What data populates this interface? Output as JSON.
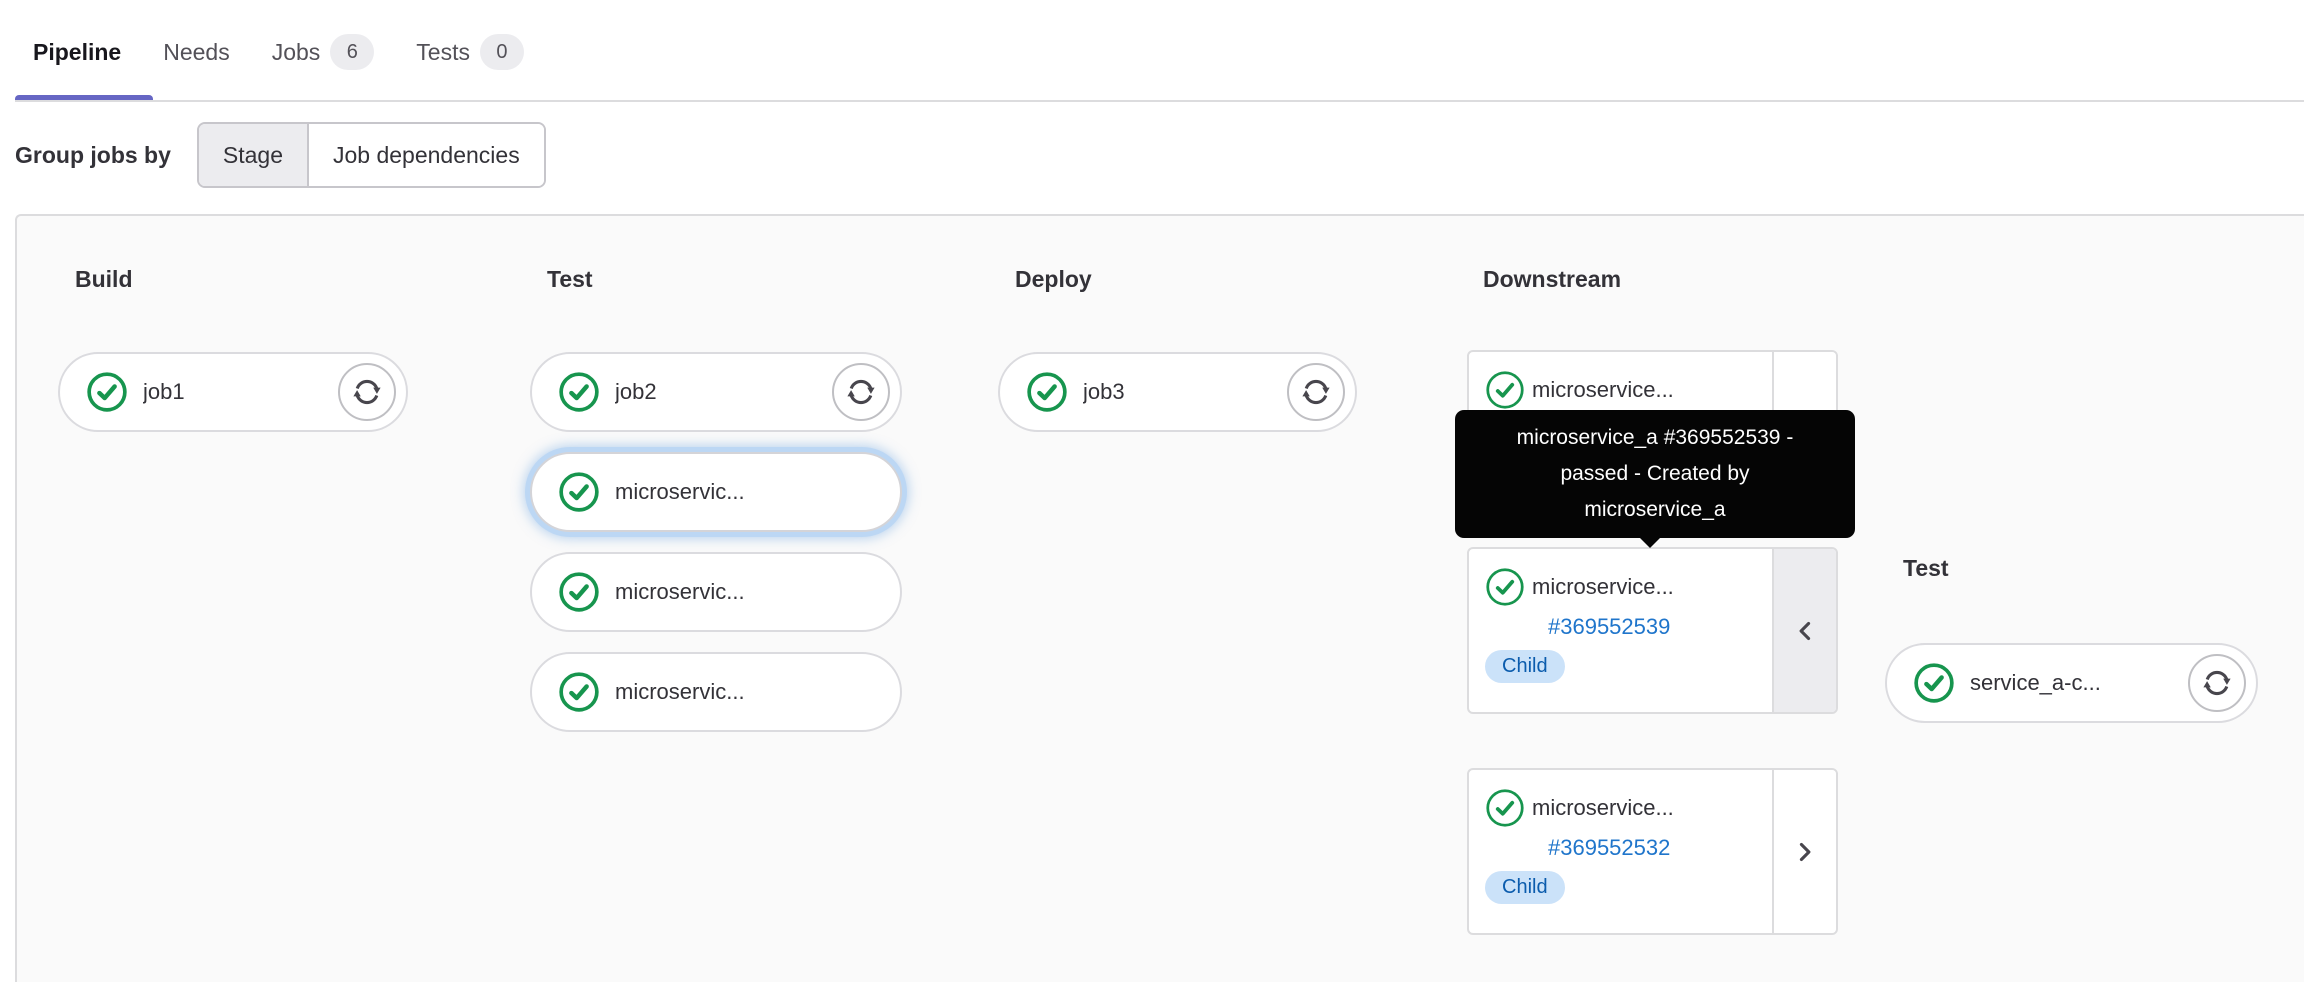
{
  "colors": {
    "tab_indicator": "#6666c4",
    "success_green": "#17954e",
    "link_blue": "#1f75cb",
    "badge_info_bg": "#cbe2f9",
    "badge_info_text": "#0b5cad",
    "tooltip_bg": "#050505",
    "panel_bg": "#fafafa",
    "border_gray": "#dcdcde"
  },
  "tabs": {
    "items": [
      {
        "label": "Pipeline",
        "active": true
      },
      {
        "label": "Needs",
        "active": false
      },
      {
        "label": "Jobs",
        "badge": "6",
        "active": false
      },
      {
        "label": "Tests",
        "badge": "0",
        "active": false
      }
    ]
  },
  "toolbar": {
    "label": "Group jobs by",
    "segments": [
      {
        "label": "Stage",
        "selected": true
      },
      {
        "label": "Job dependencies",
        "selected": false
      }
    ]
  },
  "stages": [
    {
      "title": "Build",
      "jobs": [
        {
          "name": "job1",
          "status": "success",
          "retry": true
        }
      ]
    },
    {
      "title": "Test",
      "jobs": [
        {
          "name": "job2",
          "status": "success",
          "retry": true
        },
        {
          "name": "microservic...",
          "status": "success",
          "focused": true
        },
        {
          "name": "microservic...",
          "status": "success"
        },
        {
          "name": "microservic...",
          "status": "success"
        }
      ]
    },
    {
      "title": "Deploy",
      "jobs": [
        {
          "name": "job3",
          "status": "success",
          "retry": true
        }
      ]
    }
  ],
  "downstream": {
    "title": "Downstream",
    "cards": [
      {
        "name": "microservice...",
        "status": "success"
      },
      {
        "name": "microservice...",
        "status": "success",
        "pipeline_id": "#369552539",
        "badge": "Child",
        "toggle": "collapse"
      },
      {
        "name": "microservice...",
        "status": "success",
        "pipeline_id": "#369552532",
        "badge": "Child",
        "toggle": "expand"
      }
    ]
  },
  "child_pipeline": {
    "stage_title": "Test",
    "jobs": [
      {
        "name": "service_a-c...",
        "status": "success",
        "retry": true
      }
    ]
  },
  "tooltip": {
    "text": "microservice_a #369552539 - passed - Created by microservice_a",
    "lines": [
      "microservice_a #369552539 -",
      "passed - Created by",
      "microservice_a"
    ]
  },
  "icons": {
    "status_success": "check-circle",
    "retry": "circular-arrows",
    "collapse": "chevron-left",
    "expand": "chevron-right"
  }
}
